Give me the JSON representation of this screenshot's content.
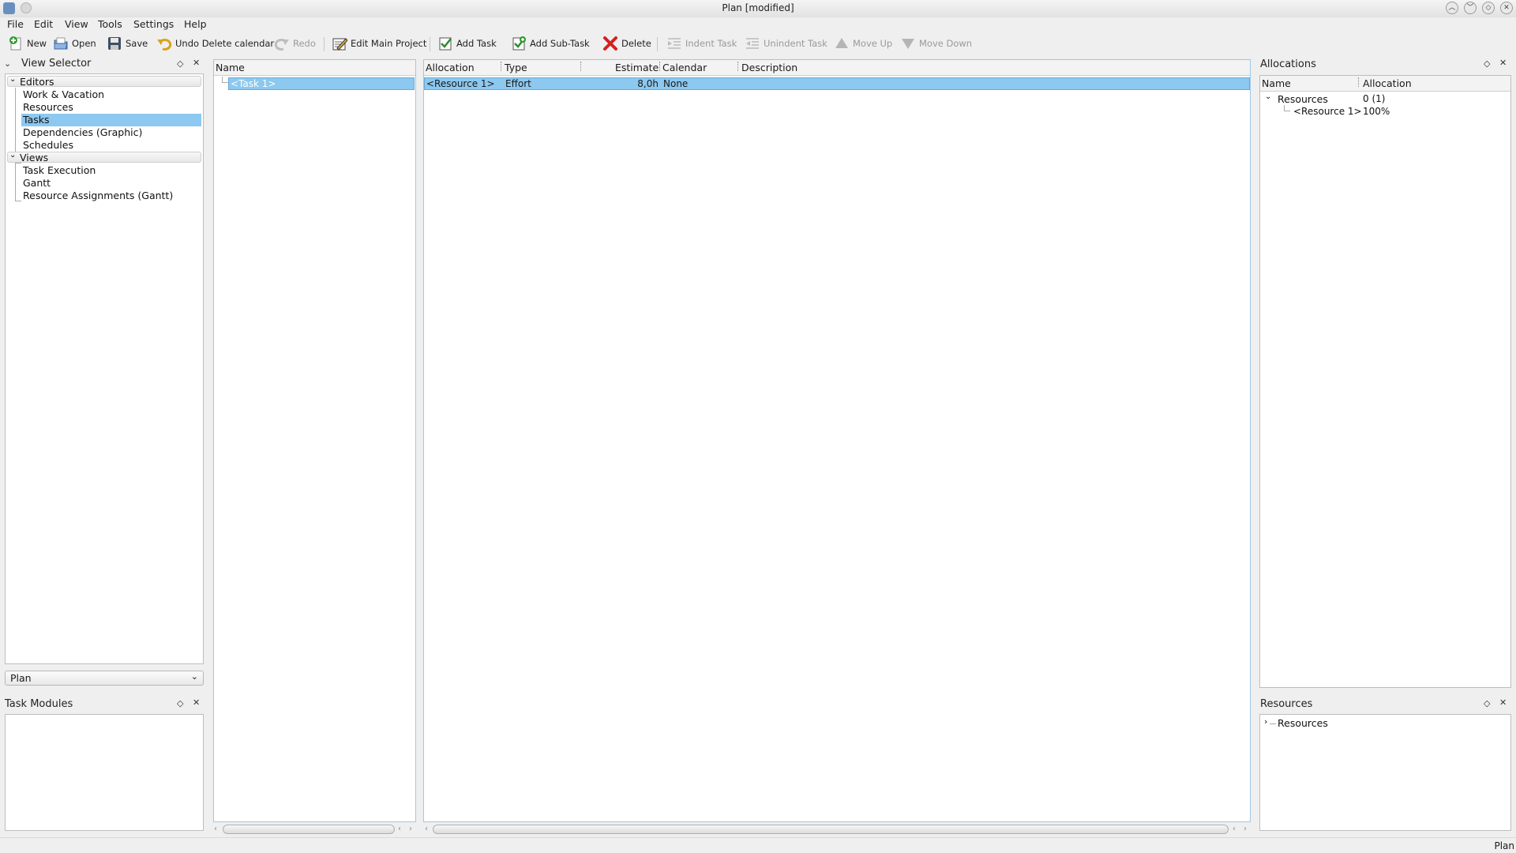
{
  "window": {
    "title": "Plan [modified]"
  },
  "menu": {
    "file": "File",
    "edit": "Edit",
    "view": "View",
    "tools": "Tools",
    "settings": "Settings",
    "help": "Help"
  },
  "toolbar": {
    "new": "New",
    "open": "Open",
    "save": "Save",
    "undo": "Undo Delete calendar",
    "redo": "Redo",
    "edit_main_project": "Edit Main Project",
    "add_task": "Add Task",
    "add_sub_task": "Add Sub-Task",
    "delete": "Delete",
    "indent_task": "Indent Task",
    "unindent_task": "Unindent Task",
    "move_up": "Move Up",
    "move_down": "Move Down"
  },
  "view_selector": {
    "title": "View Selector",
    "groups": [
      {
        "label": "Editors",
        "items": [
          "Work & Vacation",
          "Resources",
          "Tasks",
          "Dependencies (Graphic)",
          "Schedules"
        ]
      },
      {
        "label": "Views",
        "items": [
          "Task Execution",
          "Gantt",
          "Resource Assignments (Gantt)"
        ]
      }
    ],
    "selected": "Tasks",
    "combo_value": "Plan"
  },
  "task_modules": {
    "title": "Task Modules"
  },
  "task_tree": {
    "header_name": "Name",
    "rows": [
      "<Task 1>"
    ]
  },
  "allocation_table": {
    "headers": {
      "allocation": "Allocation",
      "type": "Type",
      "estimate": "Estimate",
      "calendar": "Calendar",
      "description": "Description"
    },
    "rows": [
      {
        "allocation": "<Resource 1>",
        "type": "Effort",
        "estimate": "8,0h",
        "calendar": "None",
        "description": ""
      }
    ]
  },
  "allocations_panel": {
    "title": "Allocations",
    "headers": {
      "name": "Name",
      "allocation": "Allocation"
    },
    "root": {
      "name": "Resources",
      "value": "0 (1)"
    },
    "child": {
      "name": "<Resource 1>",
      "value": "100%"
    }
  },
  "resources_panel": {
    "title": "Resources",
    "root": "Resources"
  },
  "statusbar": {
    "text": "Plan"
  },
  "colors": {
    "selection": "#8cc8ef",
    "sidebar_selection": "#8cc8ef",
    "panel_bg": "#efefef"
  }
}
